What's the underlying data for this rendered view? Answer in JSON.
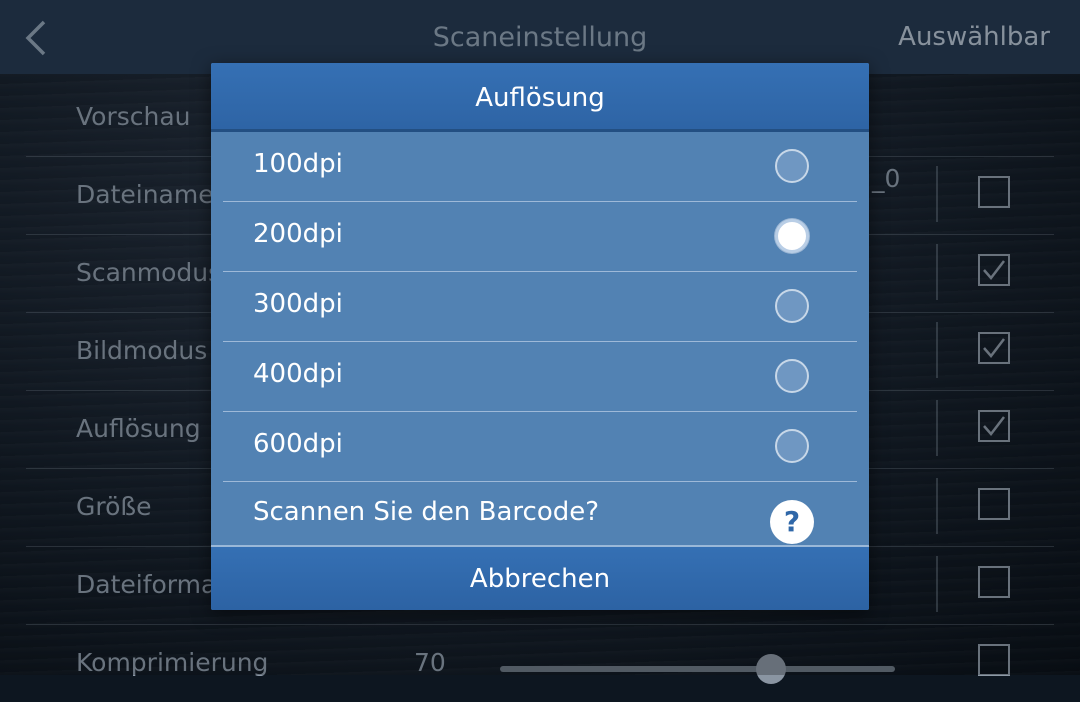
{
  "topbar": {
    "title": "Scaneinstellung",
    "action": "Auswählbar"
  },
  "settings": [
    {
      "label": "Vorschau"
    },
    {
      "label": "Dateiname",
      "value": "_0",
      "checked": false
    },
    {
      "label": "Scanmodus",
      "checked": true
    },
    {
      "label": "Bildmodus",
      "checked": true
    },
    {
      "label": "Auflösung",
      "checked": true
    },
    {
      "label": "Größe",
      "checked": false
    },
    {
      "label": "Dateiformat",
      "checked": false
    },
    {
      "label": "Komprimierung",
      "value": "70",
      "slider_level": 0.7,
      "checked": false
    }
  ],
  "dialog": {
    "title": "Auflösung",
    "options": [
      "100dpi",
      "200dpi",
      "300dpi",
      "400dpi",
      "600dpi"
    ],
    "selected_index": 1,
    "barcode_label": "Scannen Sie den Barcode?",
    "help_symbol": "?",
    "cancel_label": "Abbrechen"
  },
  "colors": {
    "dialog_bg": "#5282b3",
    "dialog_header": "#3570b4",
    "topbar": "#263a52"
  }
}
